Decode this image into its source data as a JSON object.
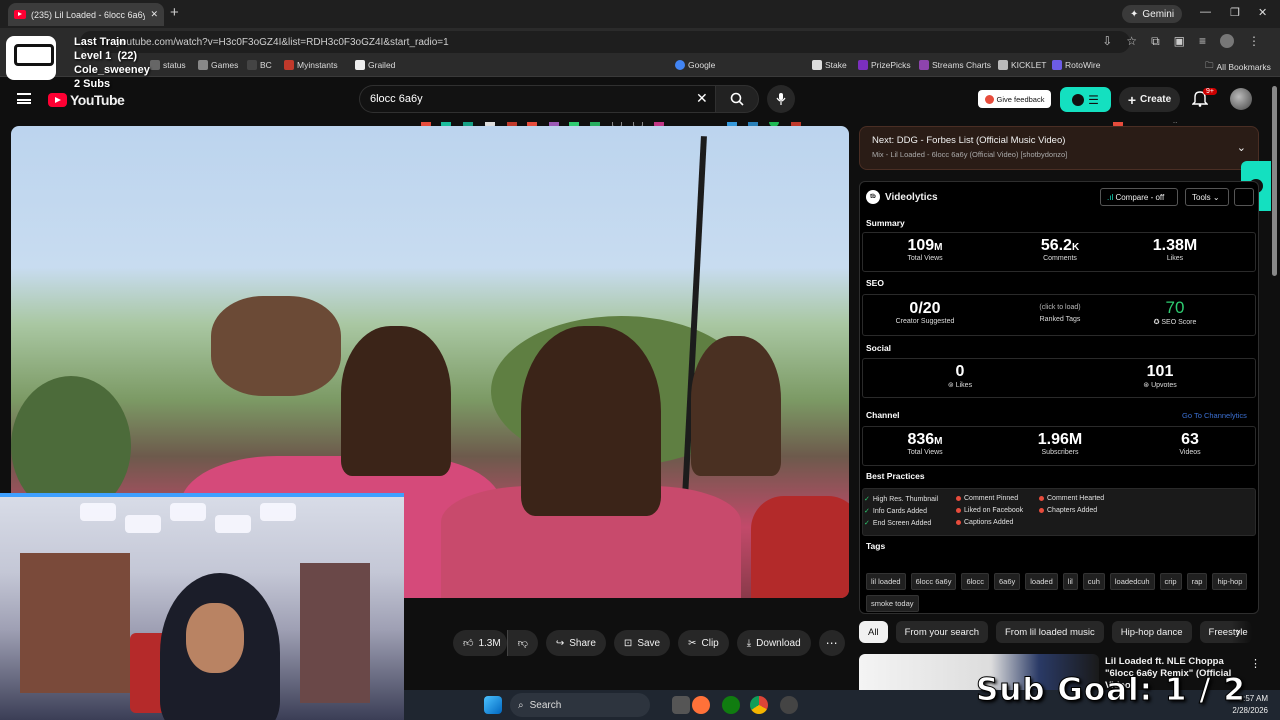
{
  "browser": {
    "tab_title": "(235) Lil Loaded - 6locc 6a6y",
    "url": "youtube.com/watch?v=H3c0F3oGZ4I&list=RDH3c0F3oGZ4I&start_radio=1",
    "gemini_label": "Gemini",
    "bookmarks": [
      "status",
      "Games",
      "BC",
      "Myinstants",
      "Grailed",
      "Google",
      "Stake",
      "PrizePicks",
      "Streams Charts",
      "KICKLET",
      "RotoWire"
    ],
    "all_bookmarks": "All Bookmarks"
  },
  "overlay": {
    "stream_title": "Last Train",
    "level": "Level 1",
    "level_count": "(22)",
    "username": "Cole_sweeney",
    "subs": "2 Subs",
    "sub_goal": "Sub Goal:  1 / 2"
  },
  "youtube": {
    "logo_text": "YouTube",
    "search_query": "6locc 6a6y",
    "give_feedback": "Give feedback",
    "create_label": "Create",
    "notifications": "9+"
  },
  "actions": {
    "like_count": "1.3M",
    "share": "Share",
    "save": "Save",
    "clip": "Clip",
    "download": "Download"
  },
  "next": {
    "title": "Next: DDG - Forbes List (Official Music Video)",
    "subtitle": "Mix - Lil Loaded - 6locc 6a6y (Official Video) [shotbydonzo]"
  },
  "videolytics": {
    "title": "Videolytics",
    "compare": "Compare - off",
    "tools": "Tools",
    "summary_title": "Summary",
    "summary": [
      {
        "value": "109",
        "unit": "M",
        "label": "Total Views"
      },
      {
        "value": "56.2",
        "unit": "K",
        "label": "Comments"
      },
      {
        "value": "1.38M",
        "unit": "",
        "label": "Likes"
      }
    ],
    "seo_title": "SEO",
    "seo": {
      "creator_value": "0/20",
      "creator_label": "Creator Suggested",
      "ranked_hint": "(click to load)",
      "ranked_label": "Ranked Tags",
      "score_value": "70",
      "score_label": "SEO Score"
    },
    "social_title": "Social",
    "social": {
      "likes_value": "0",
      "likes_label": "Likes",
      "upvotes_value": "101",
      "upvotes_label": "Upvotes"
    },
    "channel_title": "Channel",
    "channel_link": "Go To Channelytics",
    "channel": [
      {
        "value": "836",
        "unit": "M",
        "label": "Total Views"
      },
      {
        "value": "1.96M",
        "unit": "",
        "label": "Subscribers"
      },
      {
        "value": "63",
        "unit": "",
        "label": "Videos"
      }
    ],
    "best_title": "Best Practices",
    "best": [
      {
        "label": "High Res. Thumbnail",
        "ok": true
      },
      {
        "label": "Comment Pinned",
        "ok": false
      },
      {
        "label": "Comment Hearted",
        "ok": false
      },
      {
        "label": "Info Cards Added",
        "ok": true
      },
      {
        "label": "Liked on Facebook",
        "ok": false
      },
      {
        "label": "Chapters Added",
        "ok": false
      },
      {
        "label": "End Screen Added",
        "ok": true
      },
      {
        "label": "Captions Added",
        "ok": false
      }
    ],
    "tags_title": "Tags",
    "tags": [
      "lil loaded",
      "6locc 6a6y",
      "6locc",
      "6a6y",
      "loaded",
      "lil",
      "cuh",
      "loadedcuh",
      "crip",
      "rap",
      "hip-hop",
      "smoke today"
    ]
  },
  "chips": [
    "All",
    "From your search",
    "From lil loaded music",
    "Hip-hop dance",
    "Freestyle"
  ],
  "recommended": {
    "title": "Lil Loaded ft. NLE Choppa \"6locc 6a6y Remix\" (Official Video)"
  },
  "taskbar": {
    "search": "Search",
    "time": "9:57 AM",
    "date": "2/28/2026"
  },
  "colors": {
    "accent_vidiq": "#14e0c0",
    "youtube_red": "#ff0033",
    "seo_score": "#2ecc71"
  }
}
